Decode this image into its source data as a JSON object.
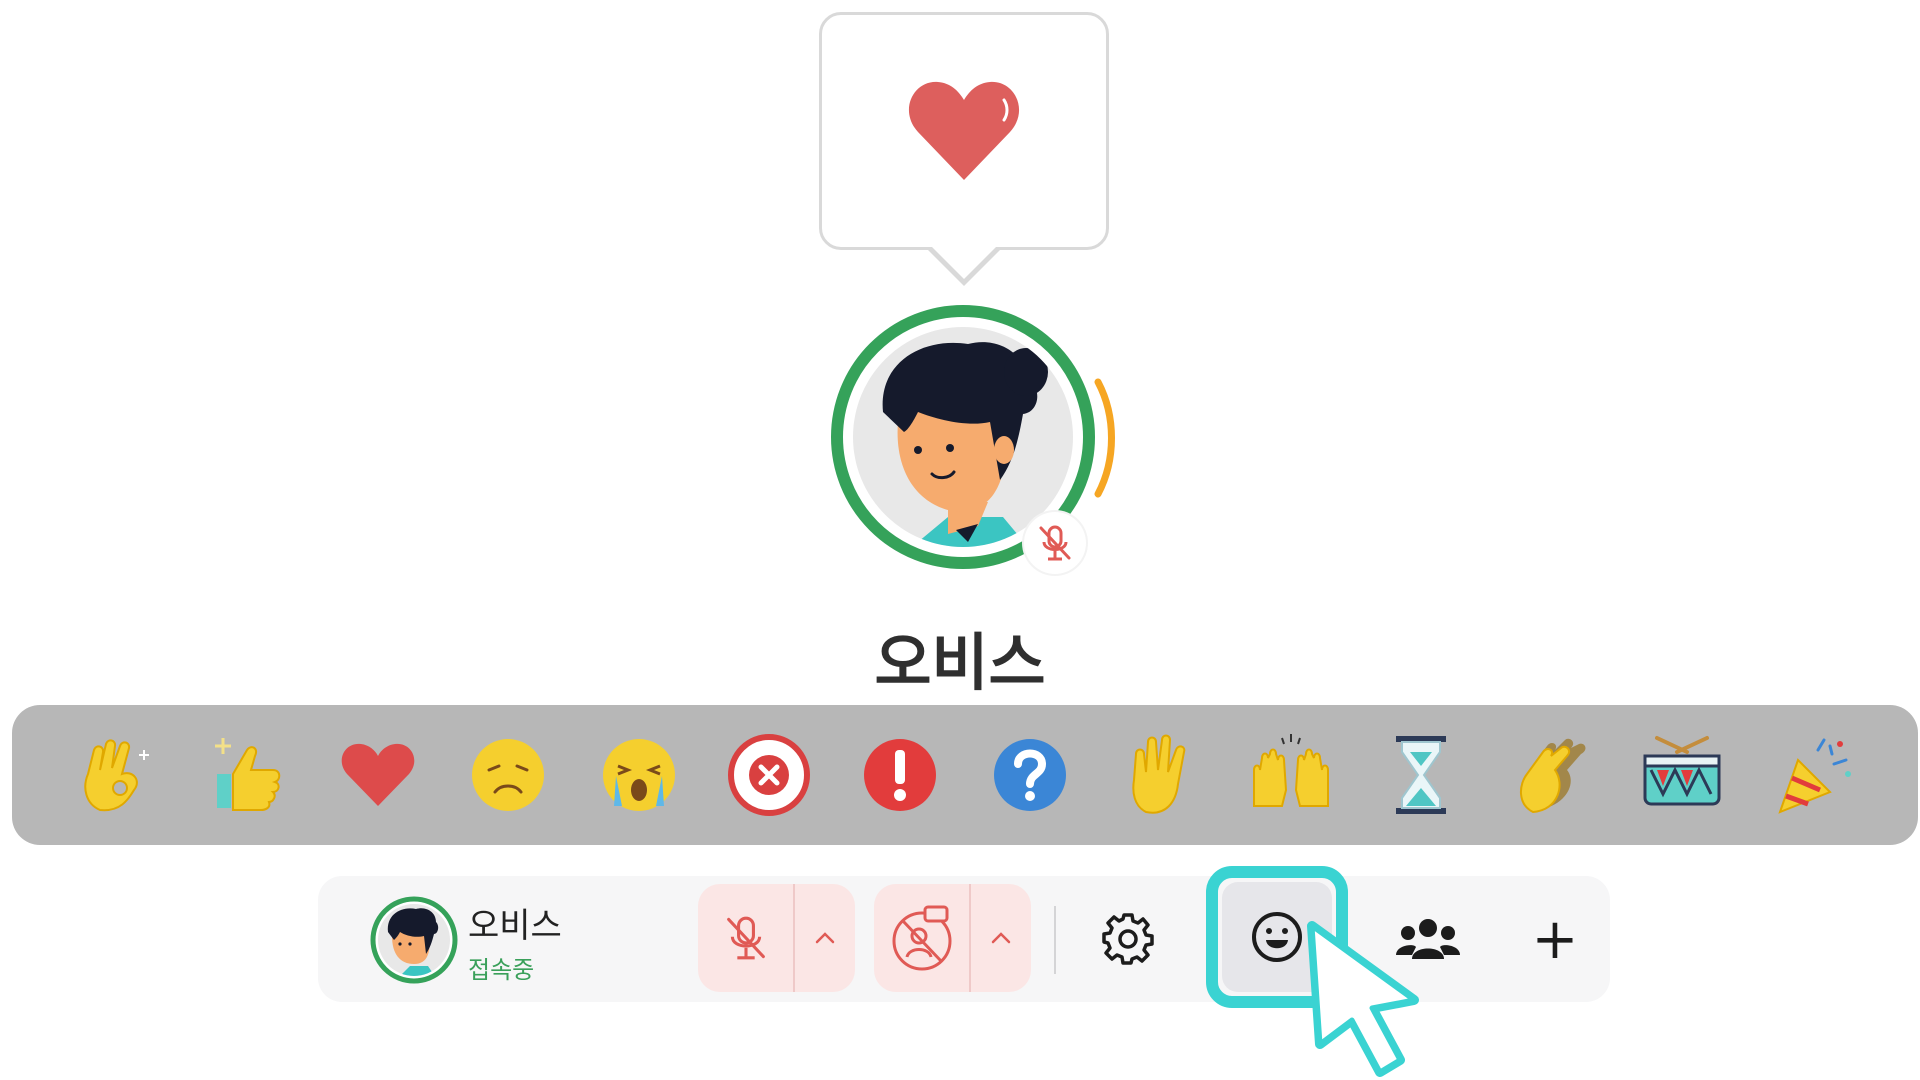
{
  "reaction": {
    "icon": "heart-icon",
    "color": "#dd5f5d"
  },
  "participant": {
    "name": "오비스",
    "ring_color": "#35a25a",
    "speaking_color": "#f6a623",
    "mic_state": "muted"
  },
  "emoji_bar": {
    "items": [
      {
        "name": "ok-hand-icon"
      },
      {
        "name": "thumbs-up-icon"
      },
      {
        "name": "heart-icon"
      },
      {
        "name": "disappointed-face-icon"
      },
      {
        "name": "crying-face-icon"
      },
      {
        "name": "cross-mark-icon"
      },
      {
        "name": "exclamation-icon"
      },
      {
        "name": "question-icon"
      },
      {
        "name": "raised-hand-icon"
      },
      {
        "name": "raising-hands-icon"
      },
      {
        "name": "hourglass-icon"
      },
      {
        "name": "clapping-hands-icon"
      },
      {
        "name": "drum-icon"
      },
      {
        "name": "party-popper-icon"
      }
    ]
  },
  "toolbar": {
    "user_name": "오비스",
    "status": "접속중",
    "mic_caret": "^",
    "camera_caret": "^",
    "add_label": "+"
  },
  "colors": {
    "accent": "#3ad3d2",
    "danger": "#e05a55",
    "online": "#3aa05a"
  }
}
